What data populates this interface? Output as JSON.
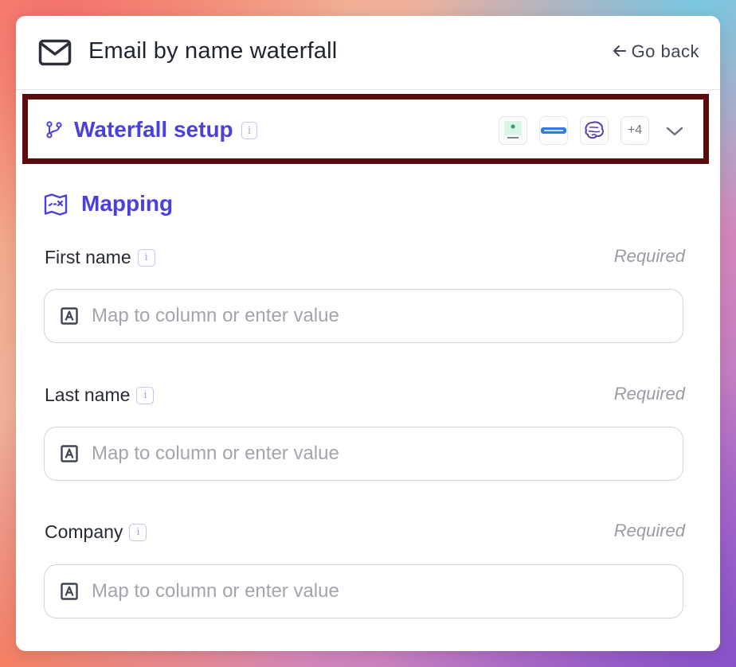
{
  "colors": {
    "accent": "#4b3fe0",
    "highlight_border": "#5b0b0b",
    "text": "#262a33",
    "muted": "#9a9ca3"
  },
  "header": {
    "icon": "mail-icon",
    "title": "Email by name waterfall",
    "go_back_label": "Go back",
    "go_back_icon": "arrow-left-icon"
  },
  "waterfall": {
    "icon": "branch-icon",
    "title": "Waterfall setup",
    "info_icon": "info-icon",
    "providers": [
      {
        "name": "tryprospect",
        "icon": "tryprospect-logo"
      },
      {
        "name": "datagma",
        "icon": "datagma-logo"
      },
      {
        "name": "brain",
        "icon": "brain-logo"
      }
    ],
    "more_count": "+4",
    "expand_icon": "chevron-down-icon"
  },
  "mapping": {
    "icon": "map-icon",
    "title": "Mapping",
    "fields": [
      {
        "label": "First name",
        "required": "Required",
        "placeholder": "Map to column or enter value",
        "value": ""
      },
      {
        "label": "Last name",
        "required": "Required",
        "placeholder": "Map to column or enter value",
        "value": ""
      },
      {
        "label": "Company",
        "required": "Required",
        "placeholder": "Map to column or enter value",
        "value": ""
      }
    ]
  }
}
